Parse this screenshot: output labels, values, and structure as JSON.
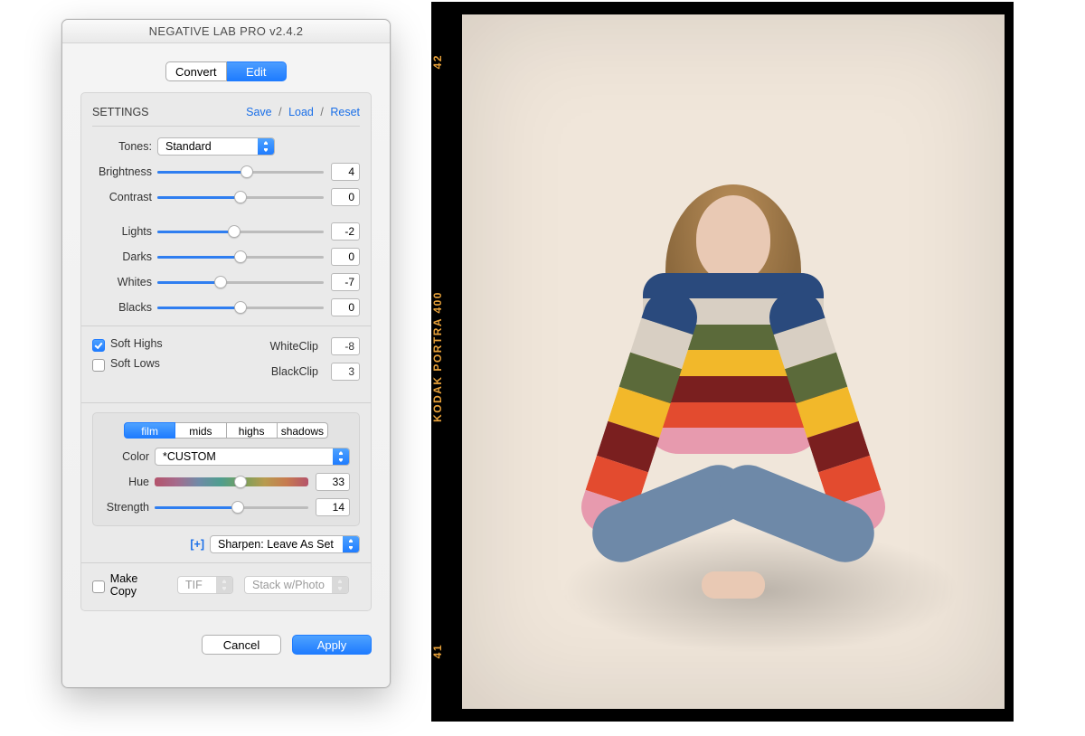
{
  "window": {
    "title": "NEGATIVE LAB PRO v2.4.2"
  },
  "modeTabs": {
    "convert": "Convert",
    "edit": "Edit",
    "active": "edit"
  },
  "settings": {
    "heading": "SETTINGS",
    "links": {
      "save": "Save",
      "load": "Load",
      "reset": "Reset"
    }
  },
  "tones": {
    "label": "Tones:",
    "value": "Standard"
  },
  "sliders": {
    "brightness": {
      "label": "Brightness",
      "value": 4,
      "pos": 54
    },
    "contrast": {
      "label": "Contrast",
      "value": 0,
      "pos": 50
    },
    "lights": {
      "label": "Lights",
      "value": -2,
      "pos": 46
    },
    "darks": {
      "label": "Darks",
      "value": 0,
      "pos": 50
    },
    "whites": {
      "label": "Whites",
      "value": -7,
      "pos": 38
    },
    "blacks": {
      "label": "Blacks",
      "value": 0,
      "pos": 50
    }
  },
  "soft": {
    "highs": {
      "label": "Soft Highs",
      "checked": true
    },
    "lows": {
      "label": "Soft Lows",
      "checked": false
    }
  },
  "clip": {
    "white": {
      "label": "WhiteClip",
      "value": -8
    },
    "black": {
      "label": "BlackClip",
      "value": 3
    }
  },
  "colorTabs": {
    "film": "film",
    "mids": "mids",
    "highs": "highs",
    "shadows": "shadows",
    "active": "film"
  },
  "color": {
    "label": "Color",
    "value": "*CUSTOM"
  },
  "hue": {
    "label": "Hue",
    "value": 33,
    "pos": 56
  },
  "strength": {
    "label": "Strength",
    "value": 14,
    "pos": 54
  },
  "sharpen": {
    "expand": "[+]",
    "label": "Sharpen: Leave As Set"
  },
  "copy": {
    "label": "Make Copy",
    "checked": false,
    "format": "TIF",
    "stack": "Stack w/Photo"
  },
  "actions": {
    "cancel": "Cancel",
    "apply": "Apply"
  },
  "film": {
    "top": "42",
    "brand": "KODAK  PORTRA  400",
    "bottom": "41"
  }
}
